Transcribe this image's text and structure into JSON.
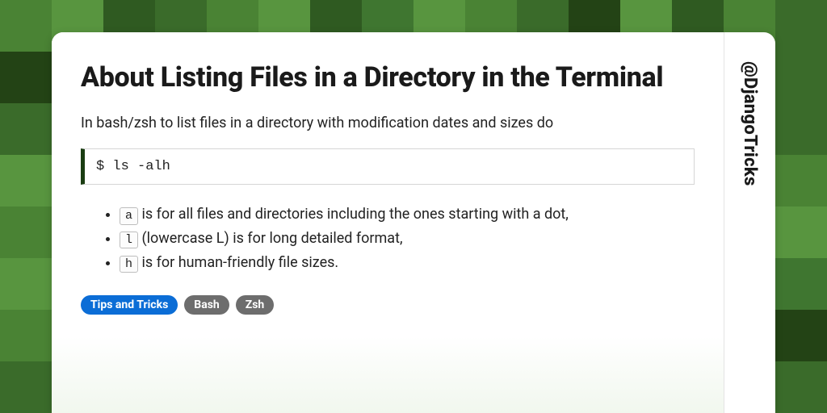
{
  "card": {
    "title": "About Listing Files in a Directory in the Terminal",
    "intro": "In bash/zsh to list files in a directory with modification dates and sizes do",
    "code": "$ ls -alh",
    "flags": [
      {
        "key": "a",
        "desc": " is for all files and directories including the ones starting with a dot,"
      },
      {
        "key": "l",
        "desc": " (lowercase L) is for long detailed format,"
      },
      {
        "key": "h",
        "desc": " is for human-friendly file sizes."
      }
    ],
    "tags": [
      {
        "label": "Tips and Tricks",
        "kind": "primary"
      },
      {
        "label": "Bash",
        "kind": "secondary"
      },
      {
        "label": "Zsh",
        "kind": "secondary"
      }
    ],
    "attribution": "@DjangoTricks"
  },
  "bg": {
    "palette": [
      "#2f5a21",
      "#3a6b2a",
      "#4a8334",
      "#58953f",
      "#234315",
      "#3f7630"
    ]
  }
}
